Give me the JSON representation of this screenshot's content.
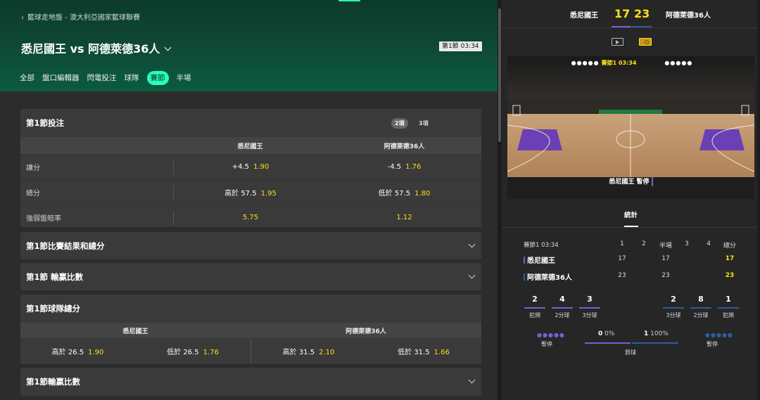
{
  "breadcrumb": "籃球走地盤 - 澳大利亞國家籃球聯賽",
  "match_title": "悉尼國王 vs 阿德萊德36人",
  "clock_badge": "第1節 03:34",
  "tabs": [
    {
      "label": "全部",
      "active": false
    },
    {
      "label": "盤口編輯器",
      "active": false
    },
    {
      "label": "閃電投注",
      "active": false
    },
    {
      "label": "球隊",
      "active": false
    },
    {
      "label": "賽節",
      "active": true
    },
    {
      "label": "半場",
      "active": false
    }
  ],
  "q1_betting": {
    "title": "第1節投注",
    "pill_2": "2項",
    "pill_3": "3項",
    "team1": "悉尼國王",
    "team2": "阿德萊德36人",
    "rows": [
      {
        "label": "讓分",
        "t1_line": "+4.5",
        "t1_odds": "1.90",
        "t2_line": "-4.5",
        "t2_odds": "1.76"
      },
      {
        "label": "總分",
        "t1_line": "高於 57.5",
        "t1_odds": "1.95",
        "t2_line": "低於 57.5",
        "t2_odds": "1.80"
      },
      {
        "label": "強弱盤賠率",
        "t1_line": "",
        "t1_odds": "5.75",
        "t2_line": "",
        "t2_odds": "1.12"
      }
    ]
  },
  "collapsed_markets": {
    "result_total": "第1節比賽結果和總分",
    "winning_margin_a": "第1節 輸贏比數",
    "winning_margin_b": "第1節輸贏比數"
  },
  "team_totals": {
    "title": "第1節球隊總分",
    "team1": "悉尼國王",
    "team2": "阿德萊德36人",
    "cells": [
      {
        "line": "高於 26.5",
        "odds": "1.90"
      },
      {
        "line": "低於 26.5",
        "odds": "1.76"
      },
      {
        "line": "高於 31.5",
        "odds": "2.10"
      },
      {
        "line": "低於 31.5",
        "odds": "1.66"
      }
    ]
  },
  "scoreboard": {
    "home_name": "悉尼國王",
    "away_name": "阿德萊德36人",
    "home_score": "17",
    "away_score": "23"
  },
  "arena": {
    "period_clock": "賽節1 03:34",
    "status_text": "悉尼國王 暫停"
  },
  "stats": {
    "tab_label": "統計",
    "period_label": "賽節1",
    "period_time": "03:34",
    "headers": [
      "1",
      "2",
      "半場",
      "3",
      "4",
      "總分"
    ],
    "home": {
      "name": "悉尼國王",
      "q1": "17",
      "half": "17",
      "total": "17"
    },
    "away": {
      "name": "阿德萊德36人",
      "q1": "23",
      "half": "23",
      "total": "23"
    },
    "home_boxes": [
      {
        "value": "2",
        "label": "犯規"
      },
      {
        "value": "4",
        "label": "2分球"
      },
      {
        "value": "3",
        "label": "3分球"
      }
    ],
    "away_boxes": [
      {
        "value": "2",
        "label": "3分球"
      },
      {
        "value": "8",
        "label": "2分球"
      },
      {
        "value": "1",
        "label": "犯規"
      }
    ],
    "timeouts_label": "暫停",
    "possession": {
      "label": "罰球",
      "home_value": "0",
      "home_pct": "0%",
      "away_value": "1",
      "away_pct": "100%"
    }
  },
  "colors": {
    "odds": "#ffdf1b",
    "accent": "#26ffbe",
    "home_team": "#7b5cd6",
    "away_team": "#2c5d9e"
  }
}
